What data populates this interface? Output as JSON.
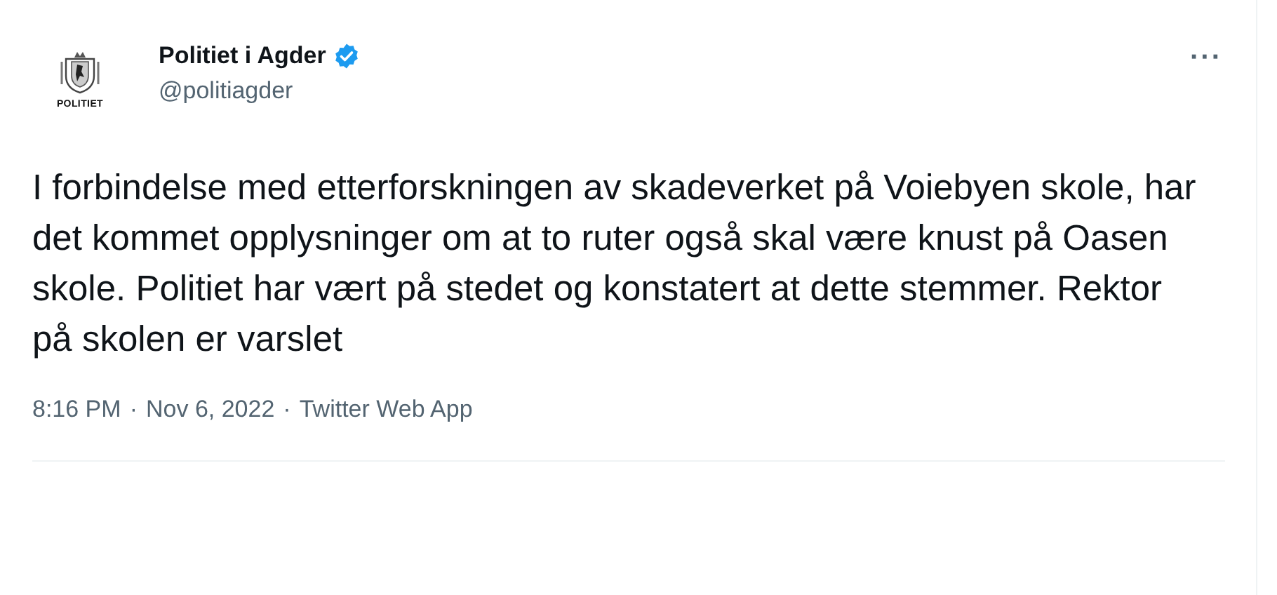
{
  "author": {
    "avatar_caption": "POLITIET",
    "name": "Politiet i Agder",
    "verified": true,
    "handle": "@politiagder"
  },
  "more_label": "···",
  "text": "I forbindelse med etterforskningen av skadeverket på Voiebyen skole, har det kommet opplysninger om at to ruter også skal være knust på Oasen skole. Politiet har vært på stedet og konstatert at dette stemmer. Rektor på skolen er varslet",
  "meta": {
    "time": "8:16 PM",
    "separator_1": "·",
    "date": "Nov 6, 2022",
    "separator_2": "·",
    "source": "Twitter Web App"
  }
}
